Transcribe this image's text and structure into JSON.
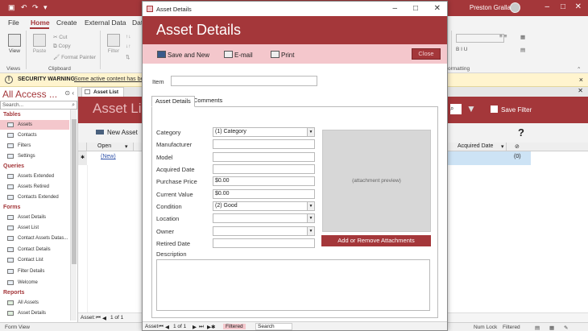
{
  "app": {
    "user": "Preston Gralla",
    "window_controls": [
      "–",
      "□",
      "✕"
    ]
  },
  "quick_access": [
    "save-icon",
    "undo-icon",
    "redo-icon",
    "customize-icon"
  ],
  "menu_tabs": [
    "File",
    "Home",
    "Create",
    "External Data",
    "Data"
  ],
  "ribbon": {
    "view_label": "View",
    "views_group": "Views",
    "paste_label": "Paste",
    "cut_label": "Cut",
    "copy_label": "Copy",
    "format_painter_label": "Format Painter",
    "clipboard_group": "Clipboard",
    "filter_label": "Filter",
    "formatting_group": "Formatting"
  },
  "security": {
    "title": "SECURITY WARNING",
    "message": "Some active content has bee",
    "close": "×"
  },
  "nav": {
    "title": "All Access ...",
    "search_placeholder": "Search...",
    "groups": [
      {
        "label": "Tables",
        "items": [
          "Assets",
          "Contacts",
          "Filters",
          "Settings"
        ]
      },
      {
        "label": "Queries",
        "items": [
          "Assets Extended",
          "Assets Retired",
          "Contacts Extended"
        ]
      },
      {
        "label": "Forms",
        "items": [
          "Asset Details",
          "Asset List",
          "Contact Assets Datas...",
          "Contact Details",
          "Contact List",
          "Filter Details",
          "Welcome"
        ]
      },
      {
        "label": "Reports",
        "items": [
          "All Assets",
          "Asset Details"
        ]
      }
    ]
  },
  "list_form": {
    "tab": "Asset List",
    "title": "Asset List",
    "save_filter": "Save Filter",
    "new_asset": "New Asset",
    "help": "?",
    "col_open": "Open",
    "col_acquired": "Acquired Date",
    "new_row": "(New)",
    "attachment_count": "(0)",
    "record_nav": {
      "label": "Asset:",
      "position": "1 of 1"
    }
  },
  "status": {
    "left": "Form View",
    "num_lock": "Num Lock",
    "filtered": "Filtered"
  },
  "dialog": {
    "window_title": "Asset Details",
    "header": "Asset Details",
    "toolbar": {
      "save_new": "Save and New",
      "email": "E-mail",
      "print": "Print",
      "close": "Close"
    },
    "item_label": "Item",
    "item_value": "",
    "tabs": [
      "Asset Details",
      "Comments"
    ],
    "fields": {
      "category": {
        "label": "Category",
        "value": "(1) Category"
      },
      "manufacturer": {
        "label": "Manufacturer",
        "value": ""
      },
      "model": {
        "label": "Model",
        "value": ""
      },
      "acquired_date": {
        "label": "Acquired Date",
        "value": ""
      },
      "purchase_price": {
        "label": "Purchase Price",
        "value": "$0.00"
      },
      "current_value": {
        "label": "Current Value",
        "value": "$0.00"
      },
      "condition": {
        "label": "Condition",
        "value": "(2) Good"
      },
      "location": {
        "label": "Location",
        "value": ""
      },
      "owner": {
        "label": "Owner",
        "value": ""
      },
      "retired_date": {
        "label": "Retired Date",
        "value": ""
      },
      "description": {
        "label": "Description",
        "value": ""
      }
    },
    "attachment_button": "Add or Remove Attachments",
    "attachment_placeholder": "(attachment preview)",
    "record_nav": {
      "label": "Asset",
      "position": "1 of 1",
      "filtered": "Filtered",
      "search": "Search"
    }
  }
}
